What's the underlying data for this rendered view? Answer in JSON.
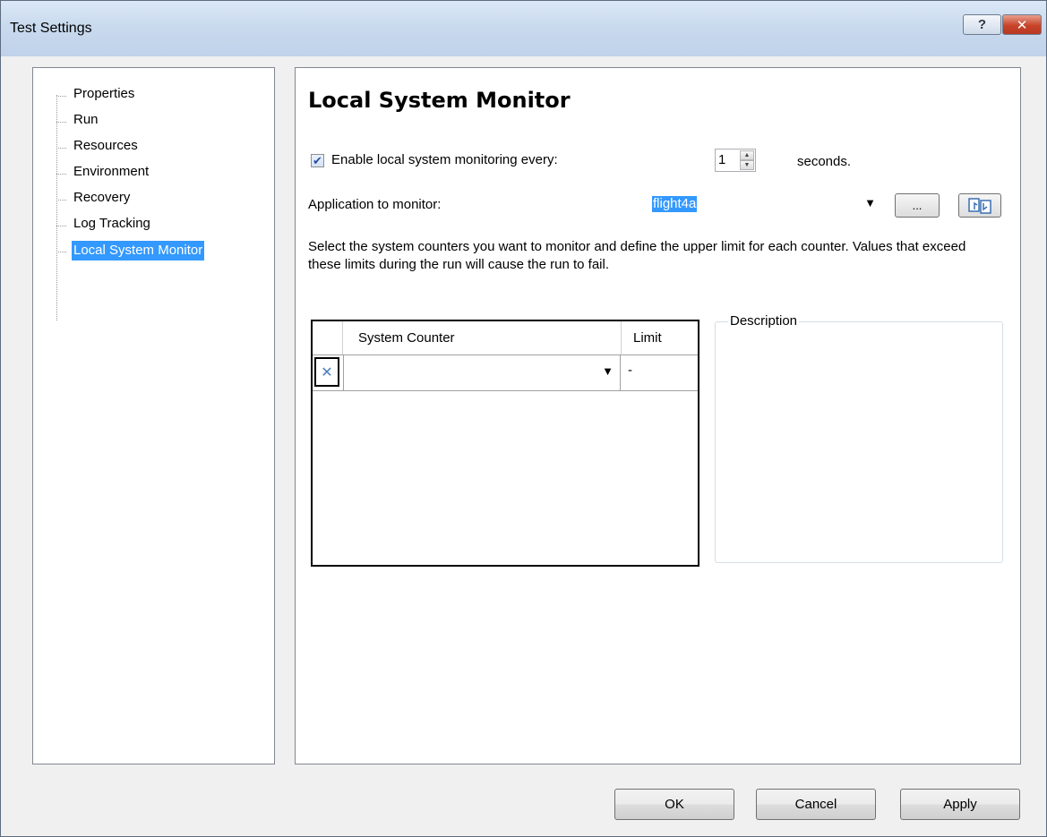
{
  "window": {
    "title": "Test Settings",
    "help_label": "?",
    "close_label": "x"
  },
  "tree": {
    "items": [
      {
        "label": "Properties"
      },
      {
        "label": "Run"
      },
      {
        "label": "Resources"
      },
      {
        "label": "Environment"
      },
      {
        "label": "Recovery"
      },
      {
        "label": "Log Tracking"
      },
      {
        "label": "Local System Monitor"
      }
    ],
    "selected": "Local System Monitor"
  },
  "panel": {
    "title": "Local System Monitor",
    "enable_label": "Enable local system monitoring every:",
    "enable_checked": true,
    "interval_value": "1",
    "interval_unit": "seconds.",
    "app_label": "Application to monitor:",
    "app_value": "flight4a",
    "browse_label": "...",
    "instructions": "Select the system counters you want to monitor and define the upper limit for each counter. Values that exceed these limits during the run will cause the run to fail."
  },
  "grid": {
    "columns": [
      "System Counter",
      "Limit"
    ],
    "rows": [
      {
        "counter": "",
        "limit": "-"
      }
    ]
  },
  "description": {
    "label": "Description",
    "text": ""
  },
  "footer": {
    "ok": "OK",
    "cancel": "Cancel",
    "apply": "Apply"
  }
}
